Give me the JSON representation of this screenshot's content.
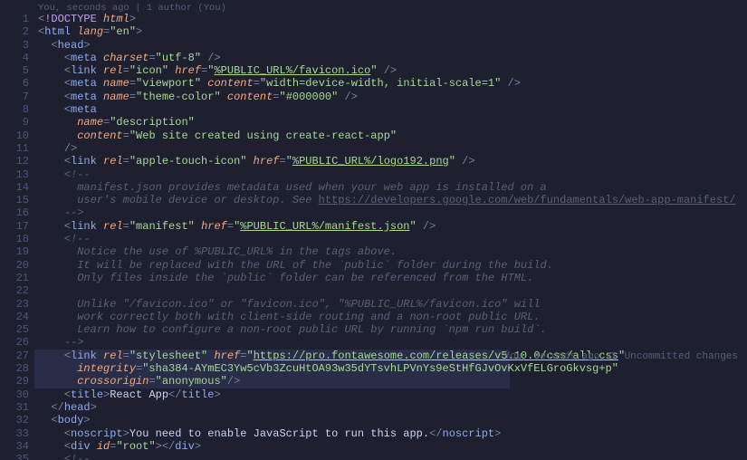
{
  "blame_top": "You, seconds ago | 1 author (You)",
  "blame_inline": "You, seconds ago",
  "blame_status": "Uncommitted changes",
  "highlight_start_line": 27,
  "lines": [
    {
      "n": 1,
      "seg": [
        [
          "punc",
          "<"
        ],
        [
          "bang",
          "!DOCTYPE"
        ],
        [
          "txt",
          " "
        ],
        [
          "attr",
          "html"
        ],
        [
          "punc",
          ">"
        ]
      ]
    },
    {
      "n": 2,
      "seg": [
        [
          "punc",
          "<"
        ],
        [
          "tag",
          "html"
        ],
        [
          "txt",
          " "
        ],
        [
          "attr",
          "lang"
        ],
        [
          "punc",
          "="
        ],
        [
          "str",
          "\"en\""
        ],
        [
          "punc",
          ">"
        ]
      ]
    },
    {
      "n": 3,
      "i": 1,
      "seg": [
        [
          "punc",
          "<"
        ],
        [
          "tag",
          "head"
        ],
        [
          "punc",
          ">"
        ]
      ]
    },
    {
      "n": 4,
      "i": 2,
      "seg": [
        [
          "punc",
          "<"
        ],
        [
          "tag",
          "meta"
        ],
        [
          "txt",
          " "
        ],
        [
          "attr",
          "charset"
        ],
        [
          "punc",
          "="
        ],
        [
          "str",
          "\"utf-8\""
        ],
        [
          "txt",
          " "
        ],
        [
          "punc",
          "/>"
        ]
      ]
    },
    {
      "n": 5,
      "i": 2,
      "seg": [
        [
          "punc",
          "<"
        ],
        [
          "tag",
          "link"
        ],
        [
          "txt",
          " "
        ],
        [
          "attr",
          "rel"
        ],
        [
          "punc",
          "="
        ],
        [
          "str",
          "\"icon\""
        ],
        [
          "txt",
          " "
        ],
        [
          "attr",
          "href"
        ],
        [
          "punc",
          "="
        ],
        [
          "str",
          "\""
        ],
        [
          "url",
          "%PUBLIC_URL%/favicon.ico"
        ],
        [
          "str",
          "\""
        ],
        [
          "txt",
          " "
        ],
        [
          "punc",
          "/>"
        ]
      ]
    },
    {
      "n": 6,
      "i": 2,
      "seg": [
        [
          "punc",
          "<"
        ],
        [
          "tag",
          "meta"
        ],
        [
          "txt",
          " "
        ],
        [
          "attr",
          "name"
        ],
        [
          "punc",
          "="
        ],
        [
          "str",
          "\"viewport\""
        ],
        [
          "txt",
          " "
        ],
        [
          "attr",
          "content"
        ],
        [
          "punc",
          "="
        ],
        [
          "str",
          "\"width=device-width, initial-scale=1\""
        ],
        [
          "txt",
          " "
        ],
        [
          "punc",
          "/>"
        ]
      ]
    },
    {
      "n": 7,
      "i": 2,
      "seg": [
        [
          "punc",
          "<"
        ],
        [
          "tag",
          "meta"
        ],
        [
          "txt",
          " "
        ],
        [
          "attr",
          "name"
        ],
        [
          "punc",
          "="
        ],
        [
          "str",
          "\"theme-color\""
        ],
        [
          "txt",
          " "
        ],
        [
          "attr",
          "content"
        ],
        [
          "punc",
          "="
        ],
        [
          "str",
          "\"#000000\""
        ],
        [
          "txt",
          " "
        ],
        [
          "punc",
          "/>"
        ]
      ]
    },
    {
      "n": 8,
      "i": 2,
      "seg": [
        [
          "punc",
          "<"
        ],
        [
          "tag",
          "meta"
        ]
      ]
    },
    {
      "n": 9,
      "i": 3,
      "seg": [
        [
          "attr",
          "name"
        ],
        [
          "punc",
          "="
        ],
        [
          "str",
          "\"description\""
        ]
      ]
    },
    {
      "n": 10,
      "i": 3,
      "seg": [
        [
          "attr",
          "content"
        ],
        [
          "punc",
          "="
        ],
        [
          "str",
          "\"Web site created using create-react-app\""
        ]
      ]
    },
    {
      "n": 11,
      "i": 2,
      "seg": [
        [
          "punc",
          "/>"
        ]
      ]
    },
    {
      "n": 12,
      "i": 2,
      "seg": [
        [
          "punc",
          "<"
        ],
        [
          "tag",
          "link"
        ],
        [
          "txt",
          " "
        ],
        [
          "attr",
          "rel"
        ],
        [
          "punc",
          "="
        ],
        [
          "str",
          "\"apple-touch-icon\""
        ],
        [
          "txt",
          " "
        ],
        [
          "attr",
          "href"
        ],
        [
          "punc",
          "="
        ],
        [
          "str",
          "\""
        ],
        [
          "url",
          "%PUBLIC_URL%/logo192.png"
        ],
        [
          "str",
          "\""
        ],
        [
          "txt",
          " "
        ],
        [
          "punc",
          "/>"
        ]
      ]
    },
    {
      "n": 13,
      "i": 2,
      "seg": [
        [
          "cmt",
          "<!--"
        ]
      ]
    },
    {
      "n": 14,
      "i": 3,
      "seg": [
        [
          "cmt",
          "manifest.json provides metadata used when your web app is installed on a"
        ]
      ]
    },
    {
      "n": 15,
      "i": 3,
      "seg": [
        [
          "cmt",
          "user's mobile device or desktop. See "
        ],
        [
          "cmt-url",
          "https://developers.google.com/web/fundamentals/web-app-manifest/"
        ]
      ]
    },
    {
      "n": 16,
      "i": 2,
      "seg": [
        [
          "cmt",
          "-->"
        ]
      ]
    },
    {
      "n": 17,
      "i": 2,
      "seg": [
        [
          "punc",
          "<"
        ],
        [
          "tag",
          "link"
        ],
        [
          "txt",
          " "
        ],
        [
          "attr",
          "rel"
        ],
        [
          "punc",
          "="
        ],
        [
          "str",
          "\"manifest\""
        ],
        [
          "txt",
          " "
        ],
        [
          "attr",
          "href"
        ],
        [
          "punc",
          "="
        ],
        [
          "str",
          "\""
        ],
        [
          "url",
          "%PUBLIC_URL%/manifest.json"
        ],
        [
          "str",
          "\""
        ],
        [
          "txt",
          " "
        ],
        [
          "punc",
          "/>"
        ]
      ]
    },
    {
      "n": 18,
      "i": 2,
      "seg": [
        [
          "cmt",
          "<!--"
        ]
      ]
    },
    {
      "n": 19,
      "i": 3,
      "seg": [
        [
          "cmt",
          "Notice the use of %PUBLIC_URL% in the tags above."
        ]
      ]
    },
    {
      "n": 20,
      "i": 3,
      "seg": [
        [
          "cmt",
          "It will be replaced with the URL of the `public` folder during the build."
        ]
      ]
    },
    {
      "n": 21,
      "i": 3,
      "seg": [
        [
          "cmt",
          "Only files inside the `public` folder can be referenced from the HTML."
        ]
      ]
    },
    {
      "n": 22,
      "i": 3,
      "seg": [
        [
          "cmt",
          ""
        ]
      ]
    },
    {
      "n": 23,
      "i": 3,
      "seg": [
        [
          "cmt",
          "Unlike \"/favicon.ico\" or \"favicon.ico\", \"%PUBLIC_URL%/favicon.ico\" will"
        ]
      ]
    },
    {
      "n": 24,
      "i": 3,
      "seg": [
        [
          "cmt",
          "work correctly both with client-side routing and a non-root public URL."
        ]
      ]
    },
    {
      "n": 25,
      "i": 3,
      "seg": [
        [
          "cmt",
          "Learn how to configure a non-root public URL by running `npm run build`."
        ]
      ]
    },
    {
      "n": 26,
      "i": 2,
      "seg": [
        [
          "cmt",
          "-->"
        ]
      ]
    },
    {
      "n": 27,
      "i": 2,
      "seg": [
        [
          "punc",
          "<"
        ],
        [
          "tag",
          "link"
        ],
        [
          "txt",
          " "
        ],
        [
          "attr",
          "rel"
        ],
        [
          "punc",
          "="
        ],
        [
          "str",
          "\"stylesheet\""
        ],
        [
          "txt",
          " "
        ],
        [
          "attr",
          "href"
        ],
        [
          "punc",
          "="
        ],
        [
          "str",
          "\""
        ],
        [
          "url",
          "https://pro.fontawesome.com/releases/v5.10.0/css/all.css"
        ],
        [
          "str",
          "\""
        ]
      ]
    },
    {
      "n": 28,
      "i": 3,
      "seg": [
        [
          "attr",
          "integrity"
        ],
        [
          "punc",
          "="
        ],
        [
          "str",
          "\"sha384-AYmEC3Yw5cVb3ZcuHtOA93w35dYTsvhLPVnYs9eStHfGJvOvKxVfELGroGkvsg+p\""
        ]
      ]
    },
    {
      "n": 29,
      "i": 3,
      "seg": [
        [
          "attr",
          "crossorigin"
        ],
        [
          "punc",
          "="
        ],
        [
          "str",
          "\"anonymous\""
        ],
        [
          "punc",
          "/>"
        ]
      ]
    },
    {
      "n": 30,
      "i": 2,
      "seg": [
        [
          "punc",
          "<"
        ],
        [
          "tag",
          "title"
        ],
        [
          "punc",
          ">"
        ],
        [
          "txt",
          "React App"
        ],
        [
          "punc",
          "</"
        ],
        [
          "tag",
          "title"
        ],
        [
          "punc",
          ">"
        ]
      ]
    },
    {
      "n": 31,
      "i": 1,
      "seg": [
        [
          "punc",
          "</"
        ],
        [
          "tag",
          "head"
        ],
        [
          "punc",
          ">"
        ]
      ]
    },
    {
      "n": 32,
      "i": 1,
      "seg": [
        [
          "punc",
          "<"
        ],
        [
          "tag",
          "body"
        ],
        [
          "punc",
          ">"
        ]
      ]
    },
    {
      "n": 33,
      "i": 2,
      "seg": [
        [
          "punc",
          "<"
        ],
        [
          "tag",
          "noscript"
        ],
        [
          "punc",
          ">"
        ],
        [
          "txt",
          "You need to enable JavaScript to run this app."
        ],
        [
          "punc",
          "</"
        ],
        [
          "tag",
          "noscript"
        ],
        [
          "punc",
          ">"
        ]
      ]
    },
    {
      "n": 34,
      "i": 2,
      "seg": [
        [
          "punc",
          "<"
        ],
        [
          "tag",
          "div"
        ],
        [
          "txt",
          " "
        ],
        [
          "attr",
          "id"
        ],
        [
          "punc",
          "="
        ],
        [
          "str",
          "\"root\""
        ],
        [
          "punc",
          "></"
        ],
        [
          "tag",
          "div"
        ],
        [
          "punc",
          ">"
        ]
      ]
    },
    {
      "n": 35,
      "i": 2,
      "seg": [
        [
          "cmt",
          "<!--"
        ]
      ]
    }
  ]
}
